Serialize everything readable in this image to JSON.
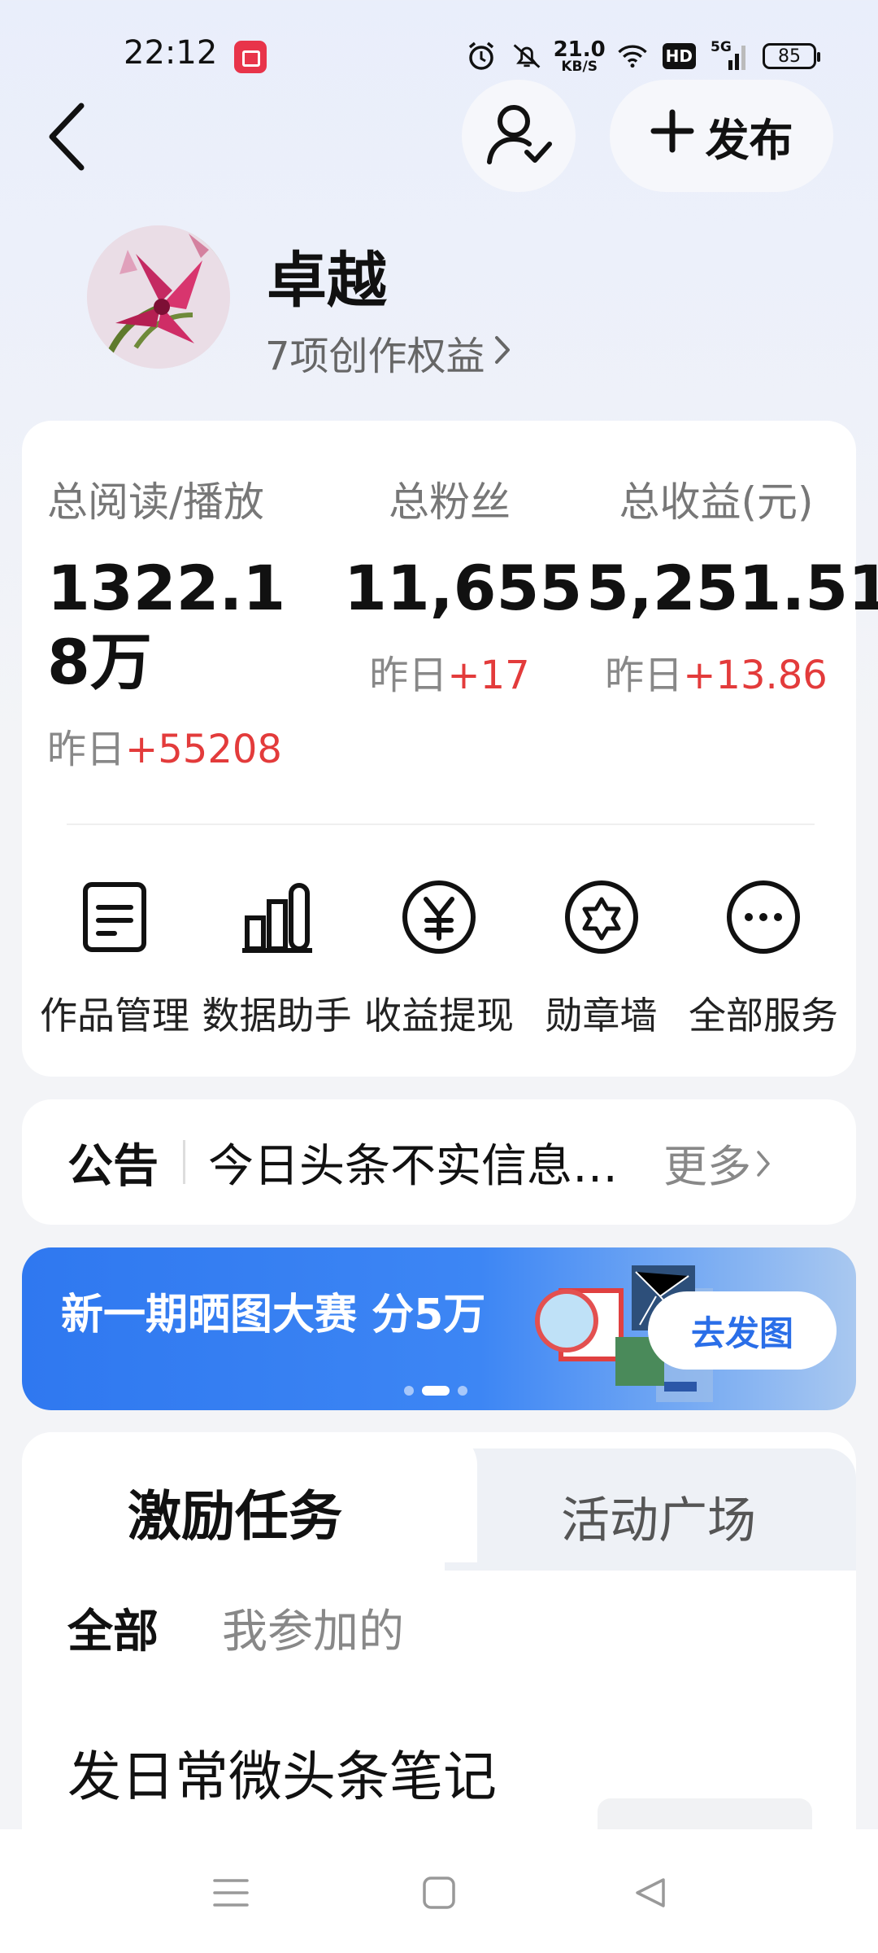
{
  "status_bar": {
    "time": "22:12",
    "net_speed_value": "21.0",
    "net_speed_unit": "KB/S",
    "hd_label": "HD",
    "signal_label": "5G",
    "battery": "85"
  },
  "header": {
    "publish_label": "发布"
  },
  "profile": {
    "name": "卓越",
    "subtitle": "7项创作权益"
  },
  "stats": [
    {
      "label": "总阅读/播放",
      "value": "1322.18万",
      "delta_prefix": "昨日",
      "delta": "+55208"
    },
    {
      "label": "总粉丝",
      "value": "11,655",
      "delta_prefix": "昨日",
      "delta": "+17"
    },
    {
      "label": "总收益(元)",
      "value": "5,251.51",
      "delta_prefix": "昨日",
      "delta": "+13.86"
    }
  ],
  "services": [
    {
      "label": "作品管理",
      "icon": "document-icon"
    },
    {
      "label": "数据助手",
      "icon": "bar-chart-icon"
    },
    {
      "label": "收益提现",
      "icon": "yuan-icon"
    },
    {
      "label": "勋章墙",
      "icon": "badge-star-icon"
    },
    {
      "label": "全部服务",
      "icon": "more-dots-icon"
    }
  ],
  "notice": {
    "title": "公告",
    "text": "今日头条不实信息…",
    "more": "更多"
  },
  "banner": {
    "title": "新一期晒图大赛 分5万",
    "button": "去发图"
  },
  "tasks": {
    "tab_active": "激励任务",
    "tab_inactive": "活动广场",
    "filter_all": "全部",
    "filter_mine": "我参加的",
    "task_title": "发日常微头条笔记"
  },
  "colors": {
    "up": "#e33b3b",
    "banner_blue": "#2f78f0",
    "banner_button_text": "#2a6ee8"
  }
}
